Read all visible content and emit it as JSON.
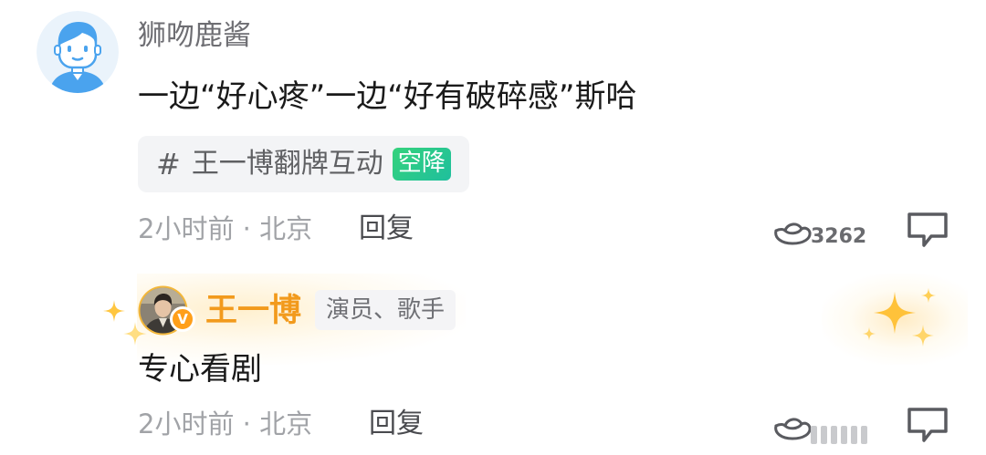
{
  "comments": [
    {
      "username": "狮吻鹿酱",
      "text": "一边“好心疼”一边“好有破碎感”斯哈",
      "topic": {
        "hash": "#",
        "label": "王一博翻牌互动",
        "badge": "空降"
      },
      "meta": "2小时前 · 北京",
      "reply_label": "回复",
      "like_count": "3262"
    },
    {
      "username": "王一博",
      "role_tag": "演员、歌手",
      "verified_mark": "V",
      "text": "专心看剧",
      "meta": "2小时前 · 北京",
      "reply_label": "回复"
    }
  ],
  "colors": {
    "star_name": "#f29a1c",
    "topic_badge": "#23c48f",
    "verified": "#ff9f1a"
  },
  "icons": [
    "default-avatar-icon",
    "like-ingot-icon",
    "comment-bubble-icon",
    "sparkle-icon"
  ]
}
